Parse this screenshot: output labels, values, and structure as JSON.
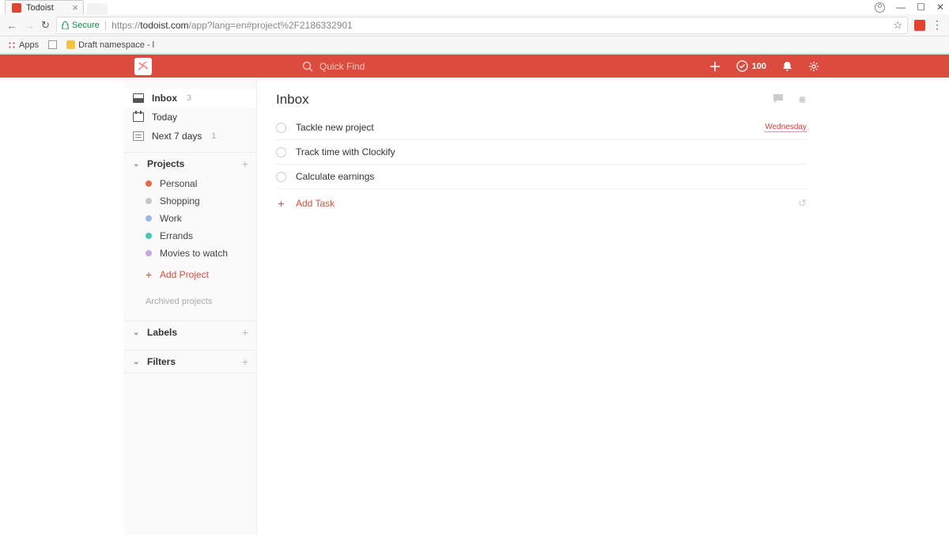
{
  "browser": {
    "tab_title": "Todoist",
    "secure_label": "Secure",
    "url_prefix": "https://",
    "url_domain": "todoist.com",
    "url_path": "/app?lang=en#project%2F2186332901",
    "bookmarks": {
      "apps": "Apps",
      "draft": "Draft namespace - l"
    }
  },
  "header": {
    "search_placeholder": "Quick Find",
    "karma_count": "100"
  },
  "sidebar": {
    "inbox": {
      "label": "Inbox",
      "count": "3"
    },
    "today": {
      "label": "Today"
    },
    "next7": {
      "label": "Next 7 days",
      "count": "1"
    },
    "sections": {
      "projects": "Projects",
      "labels": "Labels",
      "filters": "Filters"
    },
    "projects": [
      {
        "label": "Personal",
        "color": "#e9674e"
      },
      {
        "label": "Shopping",
        "color": "#c7c7c7"
      },
      {
        "label": "Work",
        "color": "#9fb8e3"
      },
      {
        "label": "Errands",
        "color": "#4bc5b7"
      },
      {
        "label": "Movies to watch",
        "color": "#c9a6dc"
      }
    ],
    "add_project": "Add Project",
    "archived": "Archived projects"
  },
  "main": {
    "title": "Inbox",
    "tasks": [
      {
        "title": "Tackle new project",
        "due": "Wednesday"
      },
      {
        "title": "Track time with Clockify",
        "due": ""
      },
      {
        "title": "Calculate earnings",
        "due": ""
      }
    ],
    "add_task": "Add Task"
  }
}
